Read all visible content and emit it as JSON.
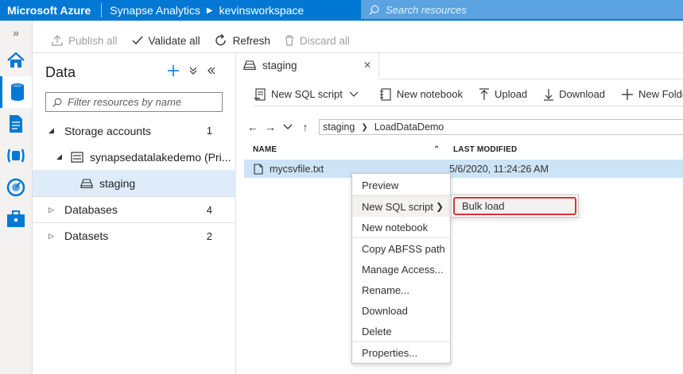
{
  "topbar": {
    "brand": "Microsoft Azure",
    "service": "Synapse Analytics",
    "workspace": "kevinsworkspace",
    "search_placeholder": "Search resources"
  },
  "rail": {
    "expand_glyph": "»",
    "icons": [
      "home-icon",
      "data-icon",
      "develop-icon",
      "orchestrate-icon",
      "monitor-icon",
      "manage-icon"
    ],
    "active": "data-icon"
  },
  "commandbar": {
    "publish": "Publish all",
    "validate": "Validate all",
    "refresh": "Refresh",
    "discard": "Discard all"
  },
  "datapanel": {
    "title": "Data",
    "filter_placeholder": "Filter resources by name",
    "tree": {
      "storage": {
        "label": "Storage accounts",
        "count": "1"
      },
      "account": {
        "label": "synapsedatalakedemo (Pri..."
      },
      "container": {
        "label": "staging"
      },
      "databases": {
        "label": "Databases",
        "count": "4"
      },
      "datasets": {
        "label": "Datasets",
        "count": "2"
      }
    }
  },
  "tab": {
    "label": "staging",
    "close_glyph": "✕"
  },
  "filetoolbar": {
    "new_sql": "New SQL script",
    "new_notebook": "New notebook",
    "upload": "Upload",
    "download": "Download",
    "new_folder": "New Folder"
  },
  "path": {
    "segments": [
      "staging",
      "LoadDataDemo"
    ]
  },
  "table": {
    "col_name": "NAME",
    "col_modified": "LAST MODIFIED",
    "rows": [
      {
        "name": "mycsvfile.txt",
        "modified": "5/6/2020, 11:24:26 AM"
      }
    ]
  },
  "contextmenu": {
    "items": [
      "Preview",
      "New SQL script",
      "New notebook",
      "Copy ABFSS path",
      "Manage Access...",
      "Rename...",
      "Download",
      "Delete",
      "Properties..."
    ],
    "submenu_items": [
      "Bulk load"
    ]
  },
  "colors": {
    "accent": "#0078d4",
    "highlight_border": "#d13438",
    "selection": "#cde4f7"
  }
}
